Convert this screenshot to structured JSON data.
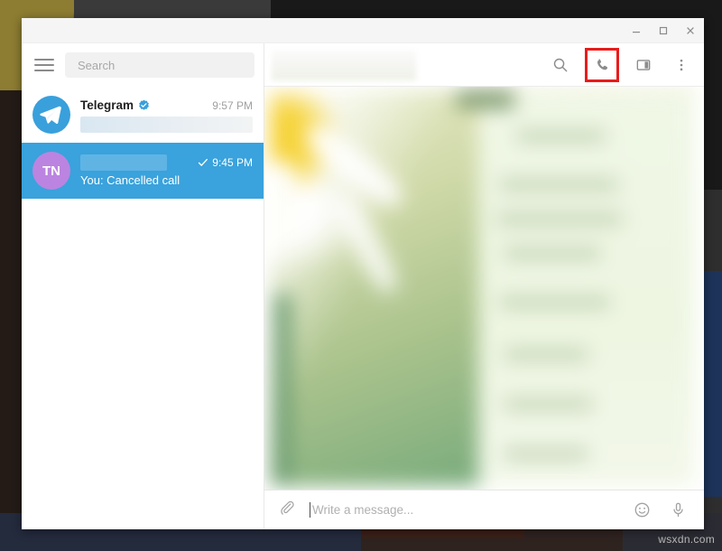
{
  "window": {
    "controls": {
      "minimize_label": "Minimize",
      "maximize_label": "Maximize",
      "close_label": "Close"
    }
  },
  "sidebar": {
    "menu_label": "Menu",
    "search": {
      "placeholder": "Search",
      "value": ""
    },
    "chats": [
      {
        "name": "Telegram",
        "verified": true,
        "time": "9:57 PM",
        "preview": "",
        "preview_redacted": true,
        "avatar_type": "telegram-logo",
        "avatar_initials": "",
        "selected": false,
        "read_check": false
      },
      {
        "name": "",
        "name_redacted": true,
        "verified": false,
        "time": "9:45 PM",
        "preview": "You: Cancelled call",
        "preview_redacted": false,
        "avatar_type": "initials",
        "avatar_initials": "TN",
        "selected": true,
        "read_check": true
      }
    ]
  },
  "chat": {
    "header": {
      "title": "",
      "title_redacted": true,
      "actions": [
        {
          "icon": "search-icon",
          "label": "Search messages",
          "highlighted": false
        },
        {
          "icon": "phone-icon",
          "label": "Call",
          "highlighted": true
        },
        {
          "icon": "panel-icon",
          "label": "Toggle info panel",
          "highlighted": false
        },
        {
          "icon": "more-vertical-icon",
          "label": "More options",
          "highlighted": false
        }
      ],
      "highlight_color": "#e81c1c"
    },
    "body_blurred": true
  },
  "composer": {
    "attach_label": "Attach file",
    "input": {
      "placeholder": "Write a message...",
      "value": ""
    },
    "emoji_label": "Emoji",
    "voice_label": "Record voice message"
  },
  "desktop": {
    "watermark": "wsxdn.com"
  },
  "colors": {
    "accent": "#39a0dc",
    "selected_row": "#3aa2dc",
    "avatar_tn": "#bb84e0",
    "highlight": "#e81c1c"
  }
}
